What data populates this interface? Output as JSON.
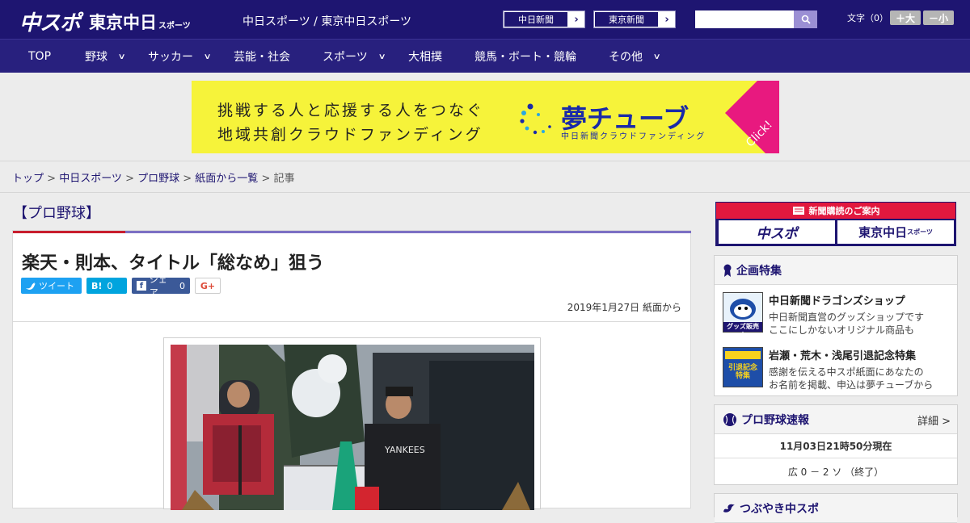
{
  "header": {
    "logo_chuspo": "中スポ",
    "logo_tokyo": "東京中日",
    "logo_tokyo_suffix": "スポーツ",
    "site_title": "中日スポーツ / 東京中日スポーツ",
    "link_chunichi": "中日新聞",
    "link_tokyo": "東京新聞",
    "link_arrow": "›",
    "search_placeholder": "",
    "font_label": "文字（0）",
    "font_larger": "＋大",
    "font_smaller": "－小"
  },
  "nav": {
    "items": [
      {
        "label": "TOP",
        "has_dropdown": false
      },
      {
        "label": "野球",
        "has_dropdown": true
      },
      {
        "label": "サッカー",
        "has_dropdown": true
      },
      {
        "label": "芸能・社会",
        "has_dropdown": false
      },
      {
        "label": "スポーツ",
        "has_dropdown": true
      },
      {
        "label": "大相撲",
        "has_dropdown": false
      },
      {
        "label": "競馬・ボート・競輪",
        "has_dropdown": false
      },
      {
        "label": "その他",
        "has_dropdown": true
      }
    ],
    "chevron": "⌄"
  },
  "ad": {
    "line1": "挑戦する人と応援する人をつなぐ",
    "line2": "地域共創クラウドファンディング",
    "brand": "夢チューブ",
    "brand_sub": "中日新聞クラウドファンディング",
    "click": "Click!",
    "bg_color": "#f6f33a",
    "accent_color": "#e8197f"
  },
  "breadcrumb": {
    "items": [
      "トップ",
      "中日スポーツ",
      "プロ野球",
      "紙面から一覧"
    ],
    "current": "記事",
    "sep": " > "
  },
  "article": {
    "category": "【プロ野球】",
    "title": "楽天・則本、タイトル「総なめ」狙う",
    "tweet_label": "ツイート",
    "hatena_label": "B!",
    "hatena_count": "0",
    "facebook_label": "シェア",
    "facebook_count": "0",
    "gplus_label": "G+",
    "date": "2019年1月27日 紙面から",
    "photo_text": "YANKEES"
  },
  "sidebar": {
    "subscribe_heading": "新聞購読のご案内",
    "subscribe_chuspo": "中スポ",
    "subscribe_tokyo": "東京中日",
    "subscribe_tokyo_suffix": "スポーツ",
    "features_heading": "企画特集",
    "features": [
      {
        "title": "中日新聞ドラゴンズショップ",
        "desc1": "中日新聞直営のグッズショップです",
        "desc2": "ここにしかないオリジナル商品も",
        "thumb_label": "グッズ販売中"
      },
      {
        "title": "岩瀬・荒木・浅尾引退記念特集",
        "desc1": "感謝を伝える中スポ紙面にあなたの",
        "desc2": "お名前を掲載、申込は夢チューブから",
        "thumb_label": "引退記念特集"
      }
    ],
    "scores_heading": "プロ野球速報",
    "scores_detail": "詳細 >",
    "scores_time": "11月03日21時50分現在",
    "scores_row": "広 0 － 2 ソ （終了）",
    "next_heading": "つぶやき中スポ"
  }
}
